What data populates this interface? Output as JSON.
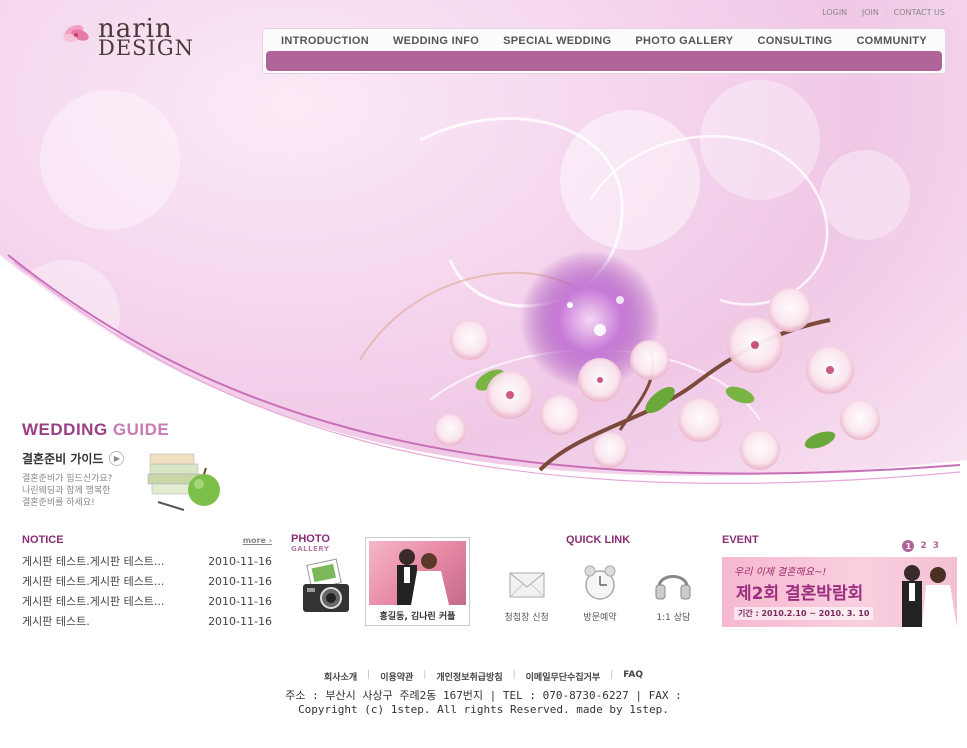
{
  "logo": {
    "word1": "narin",
    "word2": "DESIGN"
  },
  "util_links": [
    "LOGIN",
    "JOIN",
    "CONTACT US"
  ],
  "gnb": [
    "INTRODUCTION",
    "WEDDING INFO",
    "SPECIAL WEDDING",
    "PHOTO GALLERY",
    "CONSULTING",
    "COMMUNITY"
  ],
  "guide": {
    "title_strong": "WEDDING",
    "title_light": "GUIDE",
    "subtitle": "결혼준비 가이드",
    "desc": [
      "결혼준비가 힘드신가요?",
      "나린웨딩과 함께 행복한",
      "결혼준비를 하세요!"
    ]
  },
  "notice": {
    "title": "NOTICE",
    "more": "more ›",
    "items": [
      {
        "title": "게시판 테스트.게시판 테스트...",
        "date": "2010-11-16"
      },
      {
        "title": "게시판 테스트.게시판 테스트...",
        "date": "2010-11-16"
      },
      {
        "title": "게시판 테스트.게시판 테스트...",
        "date": "2010-11-16"
      },
      {
        "title": "게시판 테스트.",
        "date": "2010-11-16"
      }
    ]
  },
  "photo": {
    "title": "PHOTO",
    "sub": "GALLERY",
    "caption": "홍길동, 김나린 커플"
  },
  "quick": {
    "title": "QUICK LINK",
    "items": [
      {
        "label": "청첩장 신청",
        "icon": "envelope-icon"
      },
      {
        "label": "방문예약",
        "icon": "alarm-clock-icon"
      },
      {
        "label": "1:1 상담",
        "icon": "headset-icon"
      }
    ]
  },
  "event": {
    "title": "EVENT",
    "pages": [
      "1",
      "2",
      "3"
    ],
    "line1": "우리 이제 결혼해요~!",
    "line2": "제2회 결혼박람회",
    "line3": "기간 : 2010.2.10 ~ 2010. 3. 10"
  },
  "footer": {
    "links": [
      "회사소개",
      "이용약관",
      "개인정보취급방침",
      "이메일무단수집거부",
      "FAQ"
    ],
    "address": "주소 : 부산시 사상구 주례2동 167번지 | TEL : 070-8730-6227 | FAX :",
    "copyright": "Copyright (c) 1step. All rights Reserved. made by 1step."
  },
  "colors": {
    "accent": "#8a2f77",
    "menu_bar": "#b0649a",
    "guide": "#9a3f86"
  }
}
